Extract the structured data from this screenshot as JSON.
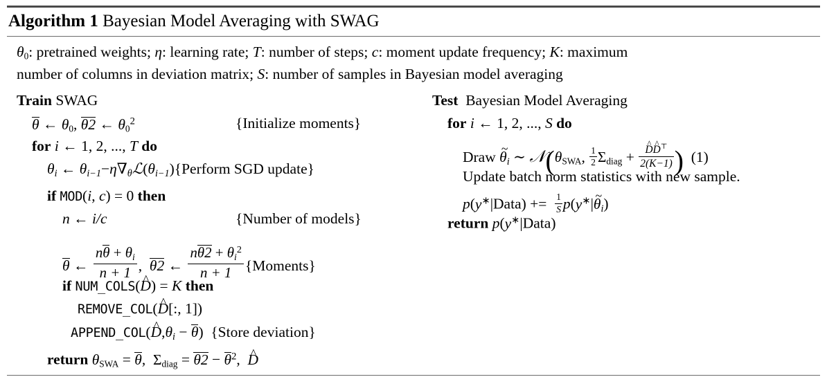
{
  "caption": {
    "label": "Algorithm 1",
    "title": "Bayesian Model Averaging with SWAG"
  },
  "parameters": {
    "line1_a": "θ",
    "line1_a_sub": "0",
    "line1_text1": ": pretrained weights; ",
    "line1_b": "η",
    "line1_text2": ": learning rate; ",
    "line1_c": "T",
    "line1_text3": ": number of steps; ",
    "line1_d": "c",
    "line1_text4": ": moment update frequency; ",
    "line1_e": "K",
    "line1_text5": ": maximum",
    "line2_text1": "number of columns in deviation matrix; ",
    "line2_f": "S",
    "line2_text2": ": number of samples in Bayesian model averaging"
  },
  "train": {
    "heading_kw": "Train",
    "heading_rest": "SWAG",
    "init": {
      "theta": "θ",
      "arrow": "←",
      "theta0": "θ",
      "theta0_sub": "0",
      "comma": ",",
      "theta2": "θ2",
      "theta0sq": "θ",
      "theta0sq_sub": "0",
      "theta0sq_sup": "2",
      "comment": "{Initialize moments}"
    },
    "for": {
      "kw_for": "for",
      "var": "i",
      "arrow": "←",
      "range": "1, 2, ...,",
      "bound": "T",
      "kw_do": "do"
    },
    "sgd": {
      "theta_i": "θ",
      "theta_i_sub": "i",
      "arrow": "←",
      "theta_im1": "θ",
      "theta_im1_sub": "i−1",
      "minus": "−",
      "eta": "η",
      "nabla": "∇",
      "nabla_sub": "θ",
      "loss": "ℒ",
      "open": "(",
      "arg": "θ",
      "arg_sub": "i−1",
      "close": ")",
      "comment": "{Perform SGD update}"
    },
    "if_mod": {
      "kw_if": "if",
      "fn": "MOD",
      "open": "(",
      "a": "i",
      "comma": ",",
      "b": "c",
      "close": ")",
      "eq": "=",
      "val": "0",
      "kw_then": "then"
    },
    "n_assign": {
      "n": "n",
      "arrow": "←",
      "expr": "i/c",
      "comment": "{Number of models}"
    },
    "moments": {
      "theta": "θ",
      "arrow": "←",
      "num1_n": "n",
      "num1_theta": "θ",
      "num1_plus": "+",
      "num1_theta_i": "θ",
      "num1_theta_i_sub": "i",
      "den1": "n + 1",
      "comma": ",",
      "theta2": "θ2",
      "arrow2": "←",
      "num2_n": "n",
      "num2_theta2": "θ2",
      "num2_plus": "+",
      "num2_theta_i": "θ",
      "num2_theta_i_sub": "i",
      "num2_theta_i_sup": "2",
      "den2": "n + 1",
      "comment": "{Moments}"
    },
    "if_numcols": {
      "kw_if": "if",
      "fn": "NUM_COLS",
      "open": "(",
      "arg": "D",
      "close": ")",
      "eq": "=",
      "val": "K",
      "kw_then": "then"
    },
    "remove_col": {
      "fn": "REMOVE_COL",
      "open": "(",
      "arg": "D",
      "idx": "[:, 1]",
      "close": ")"
    },
    "append_col": {
      "fn": "APPEND_COL",
      "open": "(",
      "arg": "D",
      "comma": ",",
      "theta_i": "θ",
      "theta_i_sub": "i",
      "minus": "−",
      "theta_bar": "θ",
      "close": ")",
      "comment": "{Store deviation}"
    },
    "return": {
      "kw": "return",
      "theta": "θ",
      "theta_sub": "SWA",
      "eq1": "=",
      "theta_bar": "θ",
      "comma1": ",",
      "sigma": "Σ",
      "sigma_sub": "diag",
      "eq2": "=",
      "theta2_bar": "θ2",
      "minus": "−",
      "theta_bar2": "θ",
      "theta_bar2_sup": "2",
      "comma2": ",",
      "dhat": "D"
    }
  },
  "test": {
    "heading_kw": "Test",
    "heading_rest": "Bayesian Model Averaging",
    "for": {
      "kw_for": "for",
      "var": "i",
      "arrow": "←",
      "range": "1, 2, ...,",
      "bound": "S",
      "kw_do": "do"
    },
    "draw": {
      "word": "Draw",
      "theta_tilde": "θ",
      "theta_tilde_sub": "i",
      "sim": "∼",
      "normal": "𝒩",
      "paren_open": "(",
      "mean": "θ",
      "mean_sub": "SWA",
      "comma": ",",
      "half_num": "1",
      "half_den": "2",
      "sigma": "Σ",
      "sigma_sub": "diag",
      "plus": "+",
      "frac_num_d1": "D",
      "frac_num_d2": "D",
      "frac_num_transpose": "⊤",
      "frac_den": "2(K−1)",
      "paren_close": ")",
      "eqno": "(1)"
    },
    "update_bn": "Update batch norm statistics with new sample.",
    "accumulate": {
      "p": "p",
      "open": "(",
      "y": "y",
      "star": "∗",
      "bar": "|",
      "data": "Data",
      "close": ")",
      "plus_eq": "+=",
      "frac_num": "1",
      "frac_den": "S",
      "p2": "p",
      "open2": "(",
      "y2": "y",
      "star2": "∗",
      "bar2": "|",
      "theta_tilde": "θ",
      "theta_tilde_sub": "i",
      "close2": ")"
    },
    "return": {
      "kw": "return",
      "p": "p",
      "open": "(",
      "y": "y",
      "star": "∗",
      "bar": "|",
      "data": "Data",
      "close": ")"
    }
  },
  "colors": {
    "rule": "#4a4a4a",
    "text": "#000000",
    "background": "#ffffff"
  }
}
